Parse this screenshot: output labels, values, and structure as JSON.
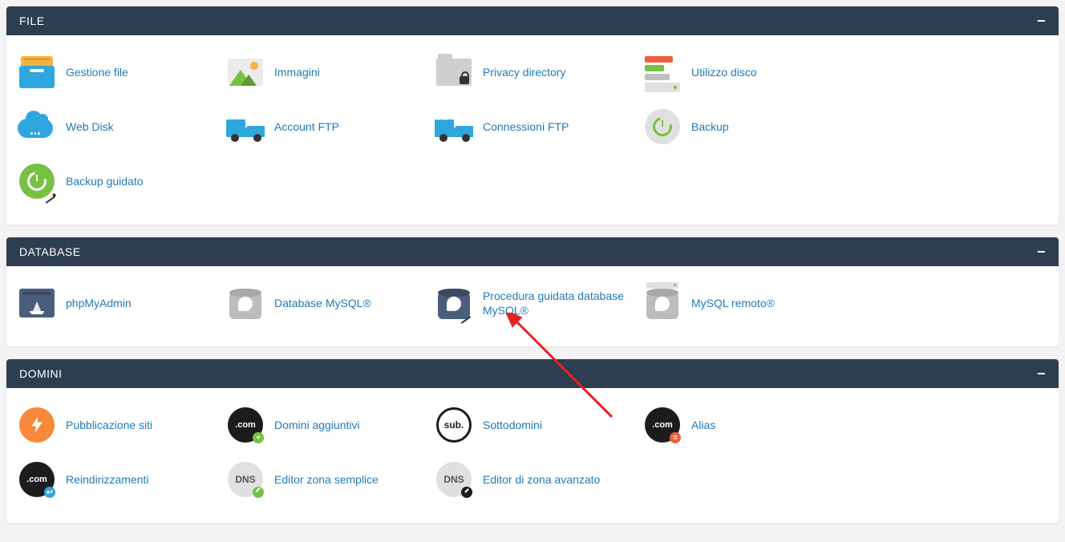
{
  "sections": {
    "file": {
      "title": "FILE",
      "items": {
        "file_manager": "Gestione file",
        "images": "Immagini",
        "privacy": "Privacy directory",
        "disk": "Utilizzo disco",
        "webdisk": "Web Disk",
        "ftp_accounts": "Account FTP",
        "ftp_connections": "Connessioni FTP",
        "backup": "Backup",
        "backup_wizard": "Backup guidato"
      }
    },
    "database": {
      "title": "DATABASE",
      "items": {
        "phpmyadmin": "phpMyAdmin",
        "mysql": "Database MySQL®",
        "mysql_wizard": "Procedura guidata database MySQL®",
        "mysql_remote": "MySQL remoto®"
      }
    },
    "domini": {
      "title": "DOMINI",
      "items": {
        "publisher": "Pubblicazione siti",
        "addon": "Domini aggiuntivi",
        "subdomains": "Sottodomini",
        "aliases": "Alias",
        "redirects": "Reindirizzamenti",
        "simple_dns": "Editor zona semplice",
        "adv_dns": "Editor di zona avanzato"
      }
    }
  }
}
